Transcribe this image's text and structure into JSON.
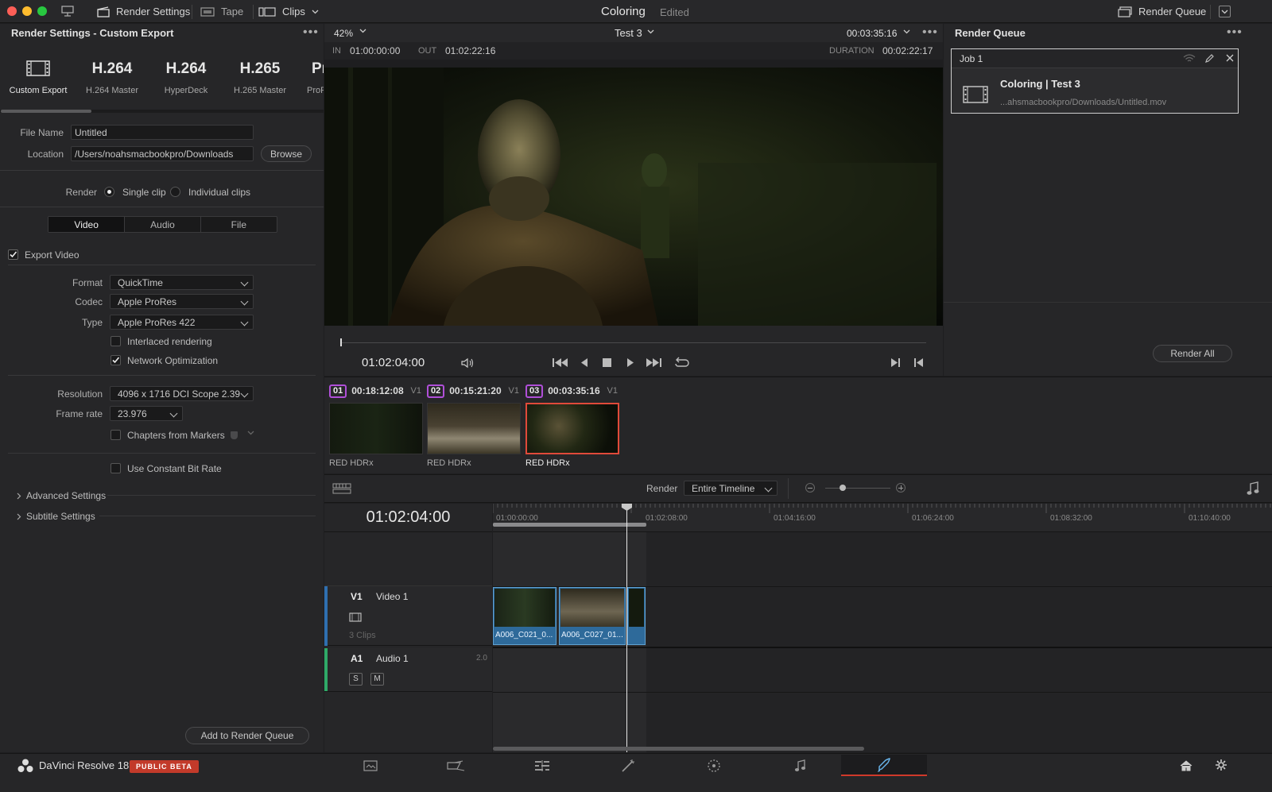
{
  "topbar": {
    "render_settings_label": "Render Settings",
    "tape_label": "Tape",
    "clips_label": "Clips",
    "project_title": "Coloring",
    "project_status": "Edited",
    "render_queue_label": "Render Queue"
  },
  "render_settings": {
    "title": "Render Settings - Custom Export",
    "presets": [
      {
        "big": "",
        "label": "Custom Export"
      },
      {
        "big": "H.264",
        "label": "H.264 Master"
      },
      {
        "big": "H.264",
        "label": "HyperDeck"
      },
      {
        "big": "H.265",
        "label": "H.265 Master"
      },
      {
        "big": "Pr",
        "label": "ProR"
      }
    ],
    "file_name_label": "File Name",
    "file_name_value": "Untitled",
    "location_label": "Location",
    "location_value": "/Users/noahsmacbookpro/Downloads",
    "browse_label": "Browse",
    "render_label": "Render",
    "single_clip_label": "Single clip",
    "individual_clips_label": "Individual clips",
    "tabs": [
      "Video",
      "Audio",
      "File"
    ],
    "export_video_label": "Export Video",
    "format_label": "Format",
    "format_value": "QuickTime",
    "codec_label": "Codec",
    "codec_value": "Apple ProRes",
    "type_label": "Type",
    "type_value": "Apple ProRes 422",
    "interlaced_label": "Interlaced rendering",
    "network_opt_label": "Network Optimization",
    "resolution_label": "Resolution",
    "resolution_value": "4096 x 1716 DCI Scope 2.39",
    "frame_rate_label": "Frame rate",
    "frame_rate_value": "23.976",
    "chapters_label": "Chapters from Markers",
    "constant_bitrate_label": "Use Constant Bit Rate",
    "advanced_label": "Advanced Settings",
    "subtitle_label": "Subtitle Settings",
    "add_queue_label": "Add to Render Queue"
  },
  "viewer": {
    "zoom": "42%",
    "timeline_name": "Test 3",
    "timecode_top": "00:03:35:16",
    "in_label": "IN",
    "in_value": "01:00:00:00",
    "out_label": "OUT",
    "out_value": "01:02:22:16",
    "duration_label": "DURATION",
    "duration_value": "00:02:22:17",
    "current_tc": "01:02:04:00"
  },
  "clips": [
    {
      "num": "01",
      "tc": "00:18:12:08",
      "track": "V1",
      "name": "RED HDRx",
      "color": "#b04fd8"
    },
    {
      "num": "02",
      "tc": "00:15:21:20",
      "track": "V1",
      "name": "RED HDRx",
      "color": "#b04fd8"
    },
    {
      "num": "03",
      "tc": "00:03:35:16",
      "track": "V1",
      "name": "RED HDRx",
      "color": "#b04fd8"
    }
  ],
  "render_queue": {
    "title": "Render Queue",
    "job_label": "Job 1",
    "job_title": "Coloring | Test 3",
    "job_path": "...ahsmacbookpro/Downloads/Untitled.mov",
    "render_all_label": "Render All"
  },
  "timeline": {
    "render_label": "Render",
    "render_range": "Entire Timeline",
    "timecode": "01:02:04:00",
    "ruler": [
      "01:00:00:00",
      "01:02:08:00",
      "01:04:16:00",
      "01:06:24:00",
      "01:08:32:00",
      "01:10:40:00"
    ],
    "v1_id": "V1",
    "v1_name": "Video 1",
    "v1_clips_count": "3 Clips",
    "a1_id": "A1",
    "a1_name": "Audio 1",
    "a1_channels": "2.0",
    "solo_label": "S",
    "mute_label": "M",
    "clip_labels": [
      "A006_C021_0...",
      "A006_C027_01..."
    ]
  },
  "footer": {
    "app_name": "DaVinci Resolve 18",
    "beta_label": "PUBLIC BETA"
  }
}
